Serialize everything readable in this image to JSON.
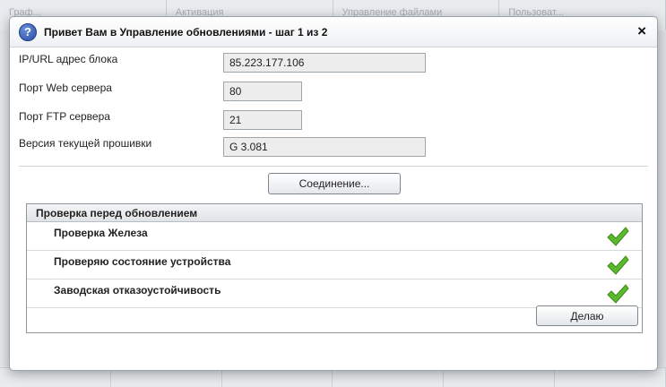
{
  "background": {
    "tabs": [
      "Граф...",
      "Активация",
      "Управление файлами",
      "Пользоват..."
    ]
  },
  "dialog": {
    "title": "Привет Вам в Управление обновлениями - шаг 1 из 2",
    "help_icon": "help-icon",
    "close_label": "×"
  },
  "form": {
    "fields": [
      {
        "label": "IP/URL адрес блока",
        "value": "85.223.177.106"
      },
      {
        "label": "Порт Web сервера",
        "value": "80"
      },
      {
        "label": "Порт FTP сервера",
        "value": "21"
      },
      {
        "label": "Версия текущей прошивки",
        "value": "G 3.081"
      }
    ]
  },
  "connect_button": "Соединение...",
  "precheck": {
    "header": "Проверка перед обновлением",
    "items": [
      {
        "label": "Проверка Железа",
        "status": "ok",
        "icon": "checkmark-icon"
      },
      {
        "label": "Проверяю состояние устройства",
        "status": "ok",
        "icon": "checkmark-icon"
      },
      {
        "label": "Заводская отказоустойчивость",
        "status": "ok",
        "icon": "checkmark-icon"
      }
    ]
  },
  "action_button": "Делаю",
  "colors": {
    "check_green": "#5cb82e",
    "help_blue": "#2a4fa6"
  }
}
